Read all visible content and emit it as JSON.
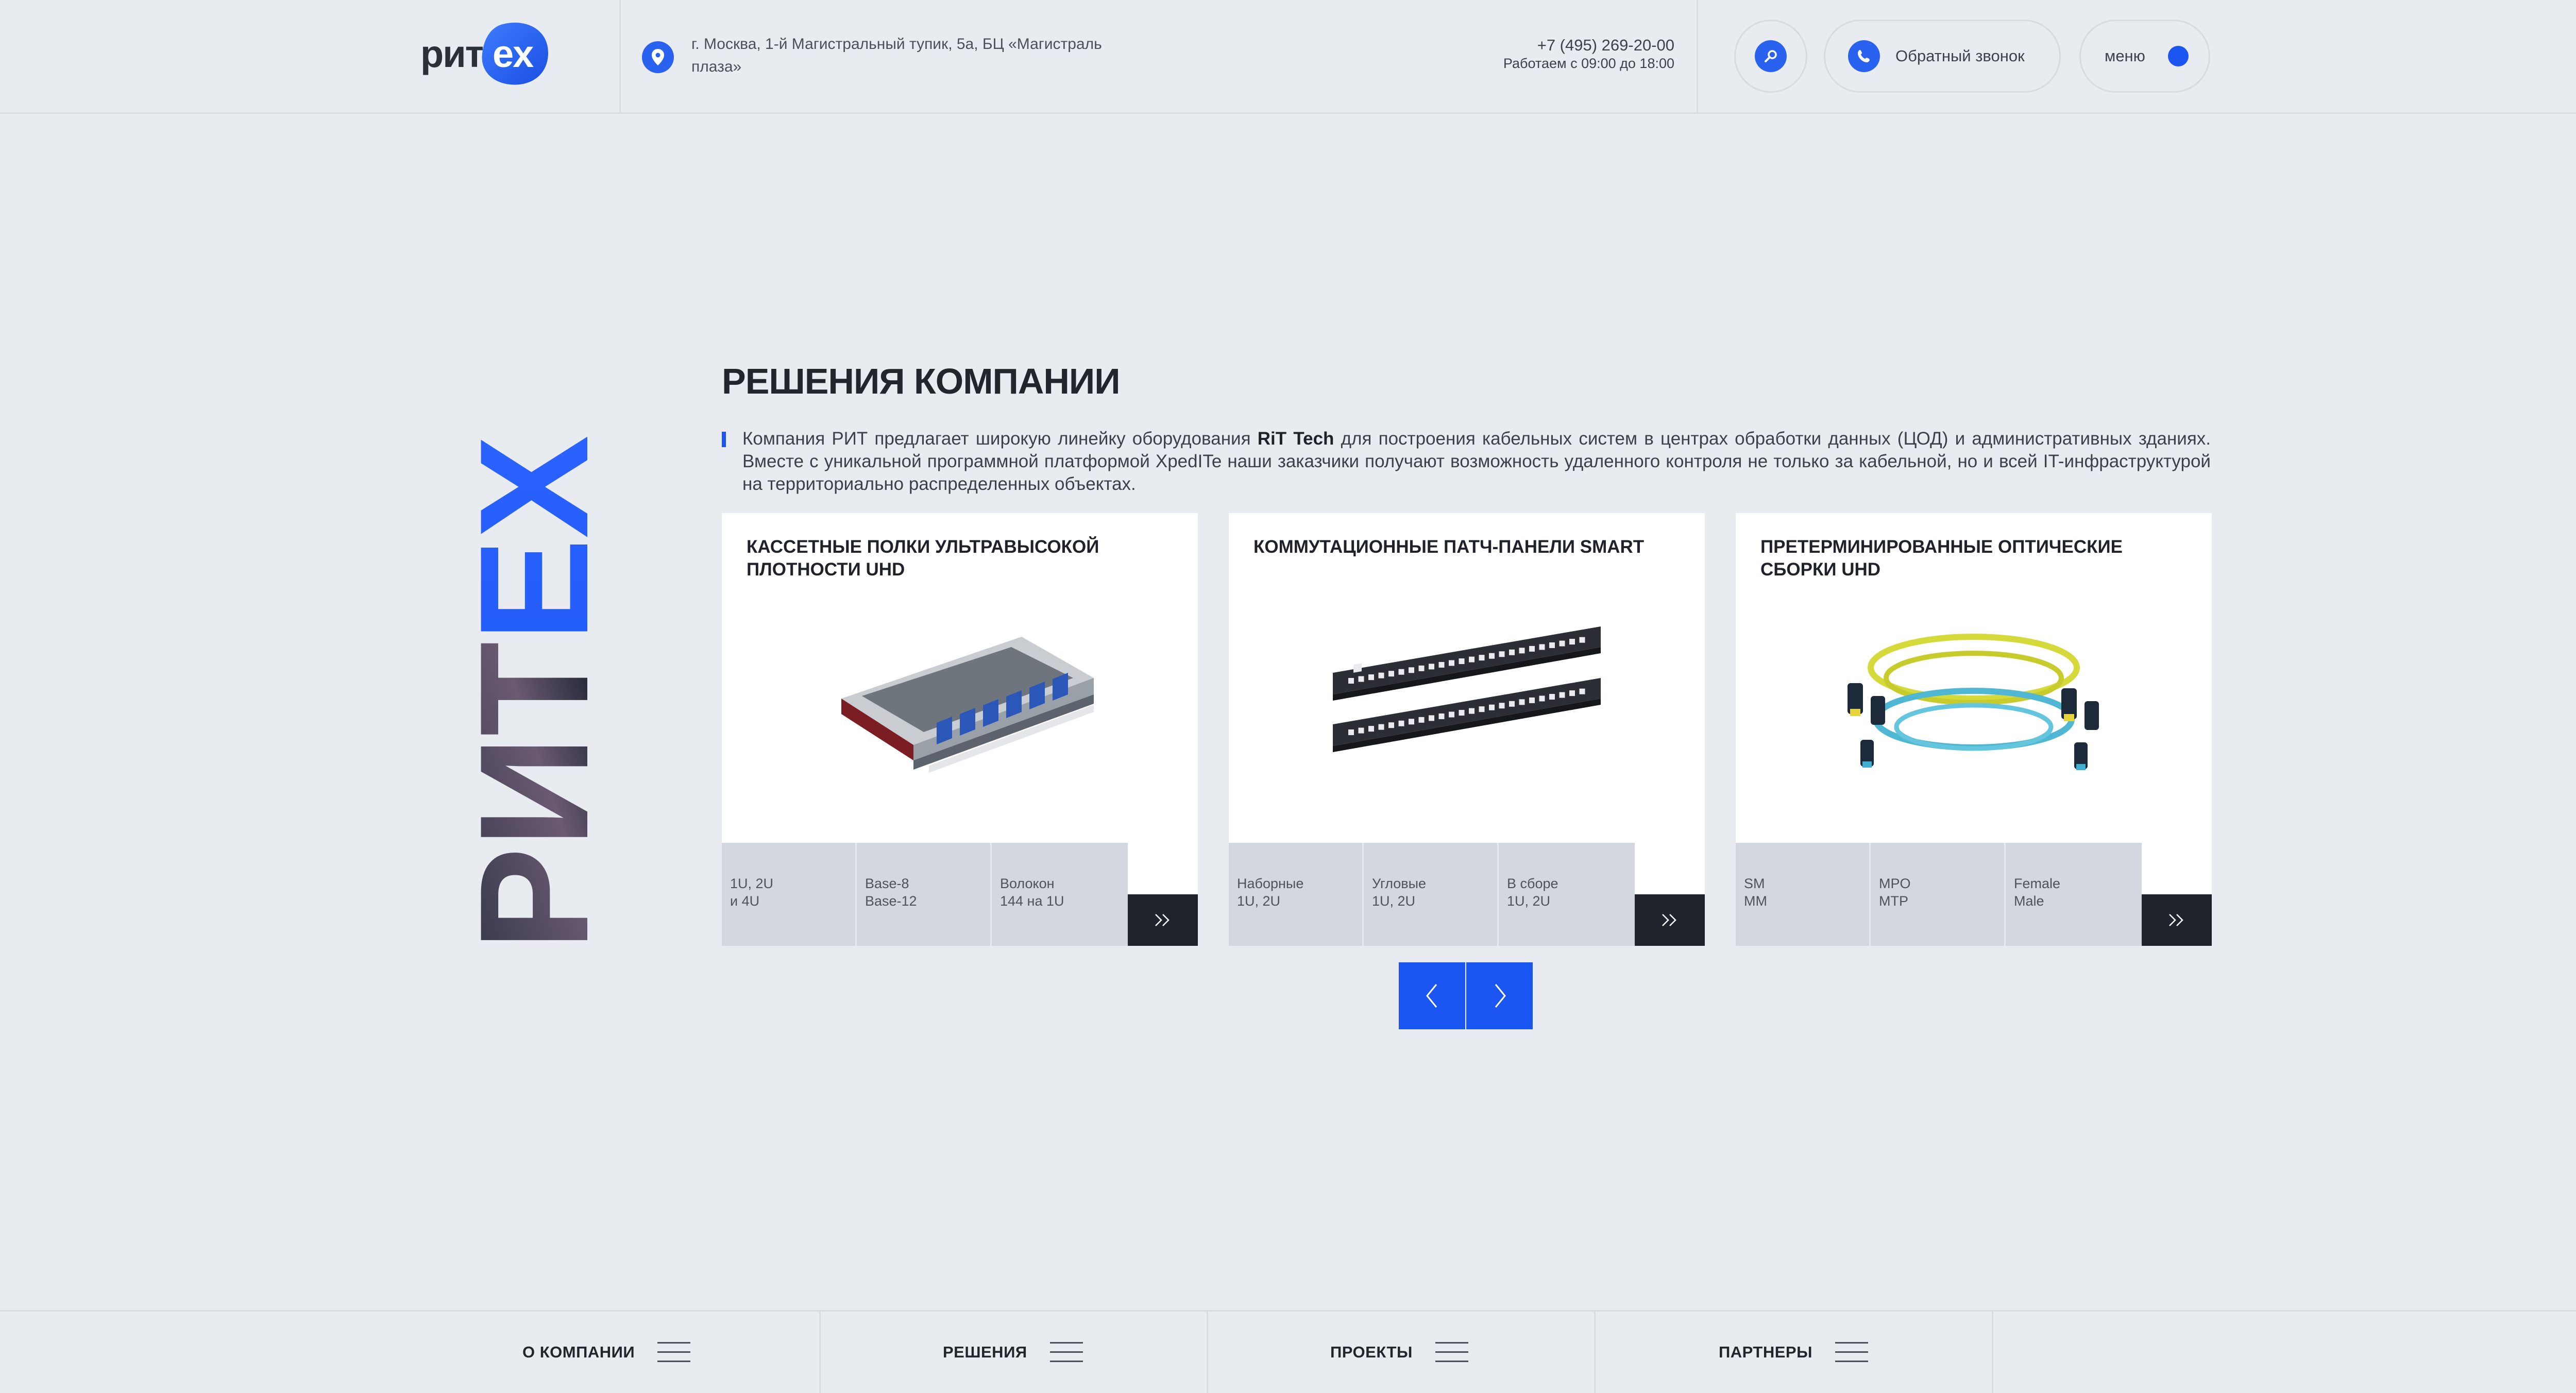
{
  "header": {
    "logo": {
      "part1": "рит",
      "part2": "ex"
    },
    "address": "г. Москва, 1-й Магистральный тупик, 5а, БЦ «Магистраль плаза»",
    "phone": "+7 (495) 269-20-00",
    "hours": "Работаем с 09:00 до 18:00",
    "callback_label": "Обратный звонок",
    "menu_label": "меню"
  },
  "brand_vertical": "РИТЕХ",
  "section": {
    "title": "РЕШЕНИЯ КОМПАНИИ",
    "intro_before": "Компания РИТ предлагает широкую линейку оборудования ",
    "intro_bold": "RiT Tech",
    "intro_after": " для построения кабельных систем в центрах обработки данных (ЦОД) и административных зданиях. Вместе с уникальной программной платформой XpedITe наши заказчики получают возможность удаленного контроля не только за кабельной, но и всей IT-инфраструктурой на территориально распределенных объектах."
  },
  "cards": [
    {
      "title": "Кассетные полки ультравысокой плотности UHD",
      "specs": [
        {
          "line1": "1U, 2U",
          "line2": "и 4U"
        },
        {
          "line1": "Base-8",
          "line2": "Base-12"
        },
        {
          "line1": "Волокон",
          "line2": "144 на 1U"
        }
      ]
    },
    {
      "title": "Коммутационные патч-панели SMART",
      "specs": [
        {
          "line1": "Наборные",
          "line2": "1U, 2U"
        },
        {
          "line1": "Угловые",
          "line2": "1U, 2U"
        },
        {
          "line1": "В сборе",
          "line2": "1U, 2U"
        }
      ]
    },
    {
      "title": "Претерминированные оптические сборки UHD",
      "specs": [
        {
          "line1": "SM",
          "line2": "MM"
        },
        {
          "line1": "MPO",
          "line2": "MTP"
        },
        {
          "line1": "Female",
          "line2": "Male"
        }
      ]
    }
  ],
  "footer_nav": [
    {
      "label": "О КОМПАНИИ"
    },
    {
      "label": "РЕШЕНИЯ"
    },
    {
      "label": "ПРОЕКТЫ"
    },
    {
      "label": "ПАРТНЕРЫ"
    }
  ],
  "colors": {
    "accent": "#1b56f2",
    "background": "#e8ebf0",
    "dark": "#1f232b"
  }
}
